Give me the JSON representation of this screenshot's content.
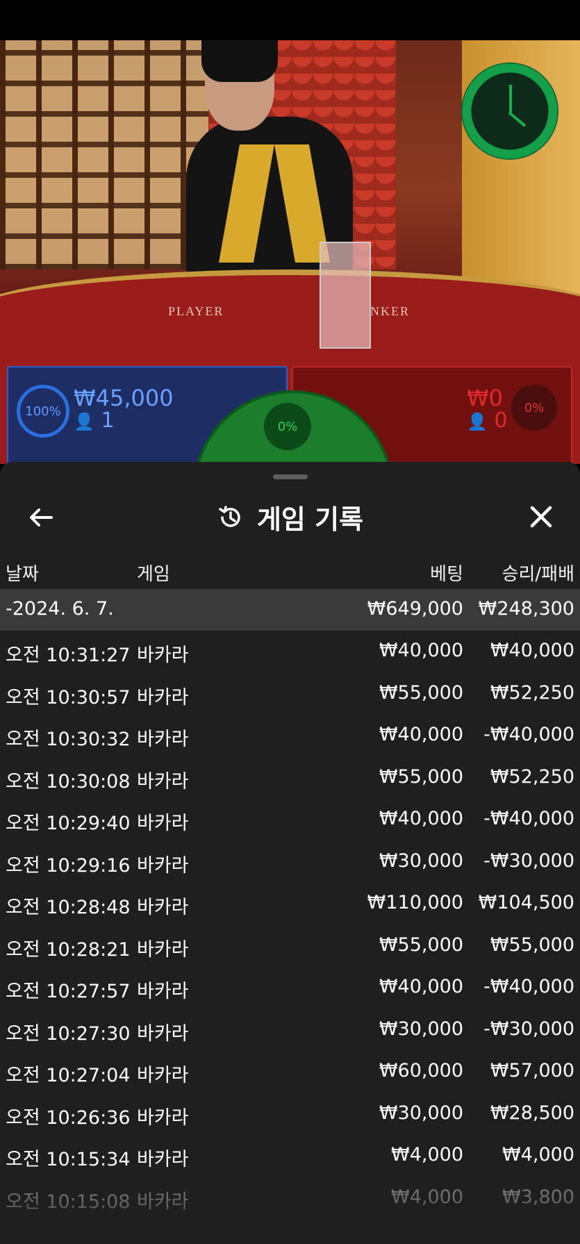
{
  "video": {
    "table_labels": {
      "player": "PLAYER",
      "banker": "NKER"
    },
    "player_bet": {
      "percent": "100%",
      "amount": "₩45,000",
      "count": "1"
    },
    "tie_bet": {
      "percent": "0%"
    },
    "banker_bet": {
      "percent": "0%",
      "amount": "₩0",
      "count": "0"
    },
    "colors": {
      "player": "#2a5fd0",
      "banker": "#c0252a",
      "tie": "#1c7d2d",
      "timer": "#14a04a"
    }
  },
  "sheet": {
    "title": "게임 기록",
    "icons": {
      "back": "arrow-left-icon",
      "history": "history-icon",
      "close": "close-icon"
    },
    "columns": {
      "date": "날짜",
      "game": "게임",
      "bet": "베팅",
      "result": "승리/패배"
    },
    "summary": {
      "date": "-2024. 6. 7.",
      "bet": "₩649,000",
      "result": "₩248,300"
    },
    "rows": [
      {
        "date": "오전 10:31:27",
        "game": "바카라",
        "bet": "₩40,000",
        "result": "₩40,000"
      },
      {
        "date": "오전 10:30:57",
        "game": "바카라",
        "bet": "₩55,000",
        "result": "₩52,250"
      },
      {
        "date": "오전 10:30:32",
        "game": "바카라",
        "bet": "₩40,000",
        "result": "-₩40,000"
      },
      {
        "date": "오전 10:30:08",
        "game": "바카라",
        "bet": "₩55,000",
        "result": "₩52,250"
      },
      {
        "date": "오전 10:29:40",
        "game": "바카라",
        "bet": "₩40,000",
        "result": "-₩40,000"
      },
      {
        "date": "오전 10:29:16",
        "game": "바카라",
        "bet": "₩30,000",
        "result": "-₩30,000"
      },
      {
        "date": "오전 10:28:48",
        "game": "바카라",
        "bet": "₩110,000",
        "result": "₩104,500"
      },
      {
        "date": "오전 10:28:21",
        "game": "바카라",
        "bet": "₩55,000",
        "result": "₩55,000"
      },
      {
        "date": "오전 10:27:57",
        "game": "바카라",
        "bet": "₩40,000",
        "result": "-₩40,000"
      },
      {
        "date": "오전 10:27:30",
        "game": "바카라",
        "bet": "₩30,000",
        "result": "-₩30,000"
      },
      {
        "date": "오전 10:27:04",
        "game": "바카라",
        "bet": "₩60,000",
        "result": "₩57,000"
      },
      {
        "date": "오전 10:26:36",
        "game": "바카라",
        "bet": "₩30,000",
        "result": "₩28,500"
      },
      {
        "date": "오전 10:15:34",
        "game": "바카라",
        "bet": "₩4,000",
        "result": "₩4,000"
      },
      {
        "date": "오전 10:15:08",
        "game": "바카라",
        "bet": "₩4,000",
        "result": "₩3,800"
      }
    ]
  }
}
